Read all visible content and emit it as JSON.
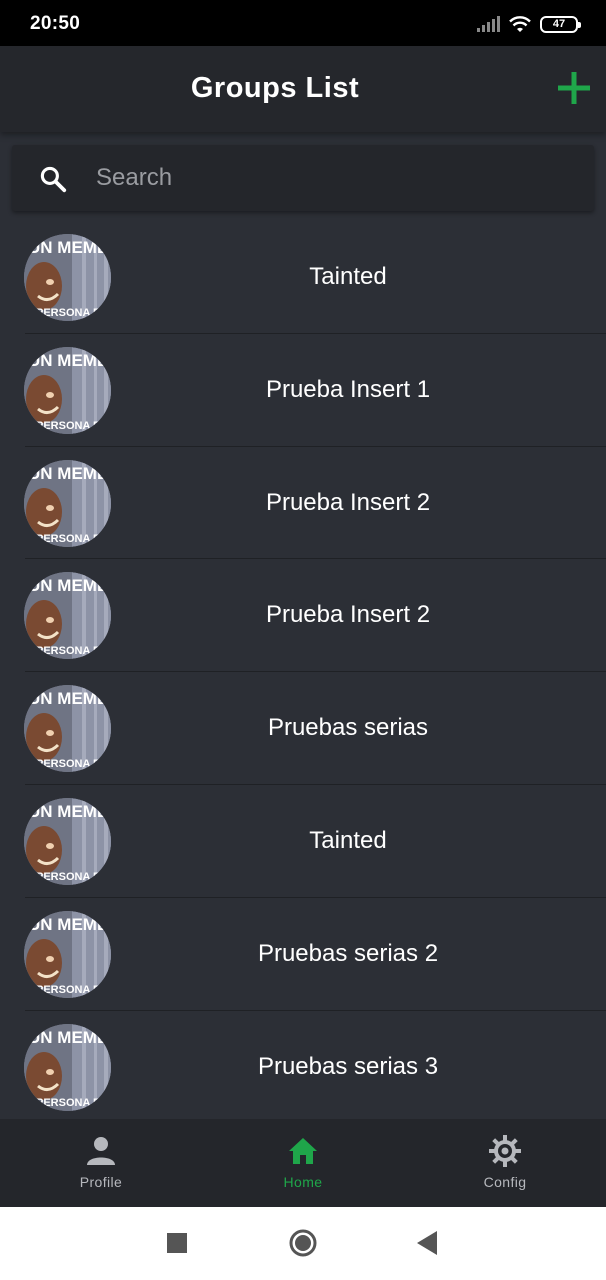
{
  "status_bar": {
    "time": "20:50",
    "battery": "47"
  },
  "app_bar": {
    "title": "Groups List",
    "accent_color": "#1fa64a"
  },
  "search": {
    "placeholder": "Search"
  },
  "groups": [
    {
      "name": "Tainted"
    },
    {
      "name": "Prueba Insert 1"
    },
    {
      "name": "Prueba Insert 2"
    },
    {
      "name": "Prueba Insert 2"
    },
    {
      "name": "Pruebas serias"
    },
    {
      "name": "Tainted"
    },
    {
      "name": "Pruebas serias 2"
    },
    {
      "name": "Pruebas serias 3"
    }
  ],
  "avatar": {
    "text_top": "UN MEME",
    "text_bottom": "PERSONA E"
  },
  "bottom_nav": {
    "items": [
      {
        "label": "Profile",
        "icon": "person-icon",
        "active": false
      },
      {
        "label": "Home",
        "icon": "home-icon",
        "active": true
      },
      {
        "label": "Config",
        "icon": "gear-icon",
        "active": false
      }
    ]
  },
  "system_nav": {
    "icons": [
      "recent-apps-icon",
      "home-circle-icon",
      "back-icon"
    ]
  }
}
